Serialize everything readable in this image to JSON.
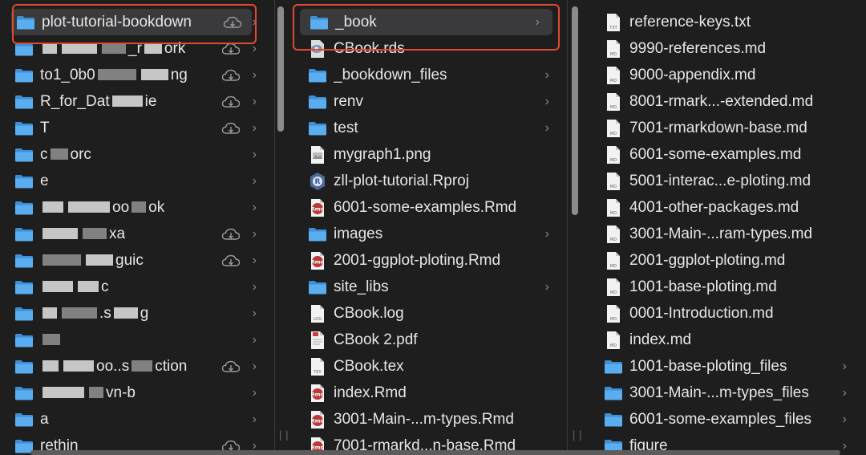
{
  "colors": {
    "background": "#1e1e1e",
    "selected_row": "#3a3a3c",
    "folder_blue": "#4aa3e8",
    "annotation_red": "#e04a2f"
  },
  "column1": {
    "items": [
      {
        "name": "plot-tutorial-bookdown",
        "icon": "folder-icon",
        "cloud": true,
        "chevron": true,
        "selected": true
      },
      {
        "name": "",
        "parts": [
          "",
          "",
          "_r",
          "ork"
        ],
        "icon": "folder-icon",
        "cloud": true,
        "chevron": true
      },
      {
        "name": "",
        "parts": [
          "to1_0b0",
          "",
          "ng"
        ],
        "icon": "folder-icon",
        "cloud": true,
        "chevron": true
      },
      {
        "name": "",
        "parts": [
          "R_for_Dat",
          "ie"
        ],
        "icon": "folder-icon",
        "cloud": true,
        "chevron": true
      },
      {
        "name": "",
        "parts": [
          "T"
        ],
        "icon": "folder-icon",
        "cloud": true,
        "chevron": true
      },
      {
        "name": "",
        "parts": [
          "c",
          "orc"
        ],
        "icon": "folder-icon",
        "cloud": false,
        "chevron": true
      },
      {
        "name": "",
        "parts": [
          "e"
        ],
        "icon": "folder-icon",
        "cloud": false,
        "chevron": true
      },
      {
        "name": "",
        "parts": [
          "",
          "oo",
          "ok"
        ],
        "icon": "folder-icon",
        "cloud": false,
        "chevron": true
      },
      {
        "name": "",
        "parts": [
          "",
          "xa"
        ],
        "icon": "folder-icon",
        "cloud": true,
        "chevron": true
      },
      {
        "name": "",
        "parts": [
          "",
          "guic"
        ],
        "icon": "folder-icon",
        "cloud": true,
        "chevron": true
      },
      {
        "name": "",
        "parts": [
          "",
          "c"
        ],
        "icon": "folder-icon",
        "cloud": false,
        "chevron": true
      },
      {
        "name": "",
        "parts": [
          "",
          ".s",
          "g"
        ],
        "icon": "folder-icon",
        "cloud": false,
        "chevron": true
      },
      {
        "name": "",
        "parts": [
          ""
        ],
        "icon": "folder-icon",
        "cloud": false,
        "chevron": true
      },
      {
        "name": "",
        "parts": [
          "",
          "oo..s",
          "ction"
        ],
        "icon": "folder-icon",
        "cloud": true,
        "chevron": true
      },
      {
        "name": "",
        "parts": [
          "",
          "vn-b"
        ],
        "icon": "folder-icon",
        "cloud": false,
        "chevron": true
      },
      {
        "name": "",
        "parts": [
          "a"
        ],
        "icon": "folder-icon",
        "cloud": false,
        "chevron": true
      },
      {
        "name": "",
        "parts": [
          "rethin"
        ],
        "icon": "folder-icon",
        "cloud": true,
        "chevron": true
      }
    ]
  },
  "column2": {
    "items": [
      {
        "name": "_book",
        "icon": "folder-icon",
        "chevron": true,
        "selected": true
      },
      {
        "name": "CBook.rds",
        "icon": "rds-file-icon",
        "chevron": false
      },
      {
        "name": "_bookdown_files",
        "icon": "folder-icon",
        "chevron": true
      },
      {
        "name": "renv",
        "icon": "folder-icon",
        "chevron": true
      },
      {
        "name": "test",
        "icon": "folder-icon",
        "chevron": true
      },
      {
        "name": "mygraph1.png",
        "icon": "png-file-icon",
        "chevron": false
      },
      {
        "name": "zll-plot-tutorial.Rproj",
        "icon": "rproj-file-icon",
        "chevron": false
      },
      {
        "name": "6001-some-examples.Rmd",
        "icon": "rmd-file-icon",
        "chevron": false
      },
      {
        "name": "images",
        "icon": "folder-icon",
        "chevron": true
      },
      {
        "name": "2001-ggplot-ploting.Rmd",
        "icon": "rmd-file-icon",
        "chevron": false
      },
      {
        "name": "site_libs",
        "icon": "folder-icon",
        "chevron": true
      },
      {
        "name": "CBook.log",
        "icon": "log-file-icon",
        "chevron": false
      },
      {
        "name": "CBook 2.pdf",
        "icon": "pdf-file-icon",
        "chevron": false
      },
      {
        "name": "CBook.tex",
        "icon": "tex-file-icon",
        "chevron": false
      },
      {
        "name": "index.Rmd",
        "icon": "rmd-file-icon",
        "chevron": false
      },
      {
        "name": "3001-Main-...m-types.Rmd",
        "icon": "rmd-file-icon",
        "chevron": false
      },
      {
        "name": "7001-rmarkd...n-base.Rmd",
        "icon": "rmd-file-icon",
        "chevron": false
      }
    ]
  },
  "column3": {
    "items": [
      {
        "name": "reference-keys.txt",
        "icon": "txt-file-icon",
        "chevron": false
      },
      {
        "name": "9990-references.md",
        "icon": "md-file-icon",
        "chevron": false
      },
      {
        "name": "9000-appendix.md",
        "icon": "md-file-icon",
        "chevron": false
      },
      {
        "name": "8001-rmark...-extended.md",
        "icon": "md-file-icon",
        "chevron": false
      },
      {
        "name": "7001-rmarkdown-base.md",
        "icon": "md-file-icon",
        "chevron": false
      },
      {
        "name": "6001-some-examples.md",
        "icon": "md-file-icon",
        "chevron": false
      },
      {
        "name": "5001-interac...e-ploting.md",
        "icon": "md-file-icon",
        "chevron": false
      },
      {
        "name": "4001-other-packages.md",
        "icon": "md-file-icon",
        "chevron": false
      },
      {
        "name": "3001-Main-...ram-types.md",
        "icon": "md-file-icon",
        "chevron": false
      },
      {
        "name": "2001-ggplot-ploting.md",
        "icon": "md-file-icon",
        "chevron": false
      },
      {
        "name": "1001-base-ploting.md",
        "icon": "md-file-icon",
        "chevron": false
      },
      {
        "name": "0001-Introduction.md",
        "icon": "md-file-icon",
        "chevron": false
      },
      {
        "name": "index.md",
        "icon": "md-file-icon",
        "chevron": false
      },
      {
        "name": "1001-base-ploting_files",
        "icon": "folder-icon",
        "chevron": true
      },
      {
        "name": "3001-Main-...m-types_files",
        "icon": "folder-icon",
        "chevron": true
      },
      {
        "name": "6001-some-examples_files",
        "icon": "folder-icon",
        "chevron": true
      },
      {
        "name": "figure",
        "icon": "folder-icon",
        "chevron": true
      }
    ]
  },
  "icons": {
    "chevron": "›",
    "grip": "||",
    "txt_label": "TXT",
    "md_label": "MD",
    "log_label": "LOG",
    "tex_label": "TEX",
    "rmd_label": "Rmd",
    "rproj_label": "R"
  }
}
